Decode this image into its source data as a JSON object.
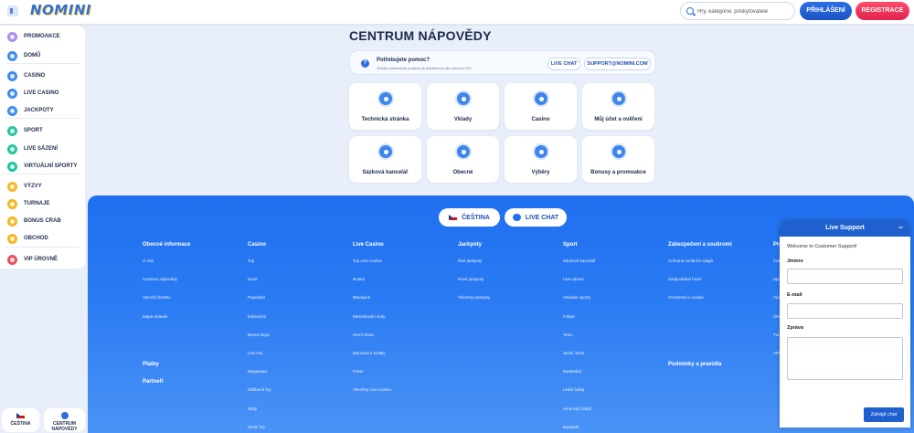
{
  "header": {
    "logo": "NOMINI",
    "search_placeholder": "Hry, kategorie, poskytovatelé",
    "login_label": "PŘIHLÁŠENÍ",
    "register_label": "REGISTRACE"
  },
  "sidebar": {
    "items": [
      {
        "label": "PROMOAKCE",
        "icon": "gift-icon",
        "color": "#a98cf0"
      },
      {
        "label": "DOMŮ",
        "icon": "home-icon",
        "color": "#3d8cf0"
      },
      {
        "label": "CASINO",
        "icon": "casino-icon",
        "color": "#3d8cf0"
      },
      {
        "label": "LIVE CASINO",
        "icon": "live-casino-icon",
        "color": "#3d8cf0"
      },
      {
        "label": "JACKPOTY",
        "icon": "jackpot-icon",
        "color": "#3d8cf0"
      },
      {
        "label": "SPORT",
        "icon": "sport-icon",
        "color": "#23c4a0"
      },
      {
        "label": "LIVE SÁZENÍ",
        "icon": "live-betting-icon",
        "color": "#23c4a0"
      },
      {
        "label": "VIRTUÁLNÍ SPORTY",
        "icon": "virtual-sports-icon",
        "color": "#23c4a0"
      },
      {
        "label": "VÝZVY",
        "icon": "challenge-icon",
        "color": "#f5b820"
      },
      {
        "label": "TURNAJE",
        "icon": "tournament-icon",
        "color": "#f5b820"
      },
      {
        "label": "BONUS CRAB",
        "icon": "crab-icon",
        "color": "#f5b820"
      },
      {
        "label": "OBCHOD",
        "icon": "shop-icon",
        "color": "#f5b820"
      },
      {
        "label": "VIP ÚROVNĚ",
        "icon": "vip-icon",
        "color": "#ef4f5e"
      }
    ],
    "bottom": [
      {
        "label": "ČEŠTINA",
        "icon": "flag-icon"
      },
      {
        "label": "CENTRUM NÁPOVĚDY",
        "icon": "help-icon"
      }
    ]
  },
  "main": {
    "title": "CENTRUM NÁPOVĚDY",
    "help": {
      "title": "Potřebujete pomoc?",
      "subtitle": "Služba zákaznické podpory je připravena vám pomoci 24/7",
      "live_chat": "LIVE CHAT",
      "email": "SUPPORT@NOMINI.COM"
    },
    "cards": [
      {
        "label": "Technická stránka",
        "icon": "gear-icon"
      },
      {
        "label": "Vklady",
        "icon": "coins-icon"
      },
      {
        "label": "Casino",
        "icon": "cards-icon"
      },
      {
        "label": "Můj účet a ověření",
        "icon": "user-icon"
      },
      {
        "label": "Sázková kancelář",
        "icon": "ball-icon"
      },
      {
        "label": "Obecné",
        "icon": "chip-icon"
      },
      {
        "label": "Výběry",
        "icon": "wallet-icon"
      },
      {
        "label": "Bonusy a promoakce",
        "icon": "gift-icon"
      }
    ]
  },
  "footer": {
    "language_button": "ČEŠTINA",
    "chat_button": "LIVE CHAT",
    "columns": [
      {
        "heading": "Obecné informace",
        "links": [
          "O nás",
          "Centrum nápovědy",
          "Vytvořit zkratku",
          "Mapa stránek"
        ],
        "extra": [
          "Platby",
          "Partneři"
        ]
      },
      {
        "heading": "Casino",
        "links": [
          "Top",
          "Nové",
          "Populární",
          "Exkluzivní",
          "Bonus Buys",
          "Live Hry",
          "Megaways",
          "Oblíbené hry",
          "Sloty",
          "Stolní hry"
        ]
      },
      {
        "heading": "Live Casino",
        "links": [
          "Top Live Casino",
          "Ruleta",
          "Blackjack",
          "Mezinárodní stoly",
          "Herní show",
          "Baccarat a kostky",
          "Poker",
          "Všechny Live Casino"
        ]
      },
      {
        "heading": "Jackpoty",
        "links": [
          "Živé jackpoty",
          "Nové jackpoty",
          "Všechny jackpoty"
        ]
      },
      {
        "heading": "Sport",
        "links": [
          "Sázková kancelář",
          "Live sázení",
          "Virtuální sporty",
          "Fotbal",
          "Tenis",
          "Stolní Tenis",
          "Basketbal",
          "Lední hokej",
          "Americký fotbal",
          "Baseball"
        ]
      },
      {
        "heading": "Zabezpečení a soukromí",
        "links": [
          "Ochrana osobních údajů",
          "Zodpovědné hraní",
          "Oznámení o cookie"
        ],
        "extra": [
          "Podmínky a pravidla"
        ]
      },
      {
        "heading": "Pro",
        "links": [
          "Casi",
          "Spor",
          "Výz",
          "Obc",
          "Turn",
          "VIP"
        ]
      }
    ]
  },
  "chat": {
    "title": "Live Support",
    "minimize": "−",
    "welcome": "Welcome to Customer Support!",
    "name_label": "Jméno",
    "email_label": "E-mail",
    "message_label": "Zpráva",
    "submit": "Zahájit chat"
  }
}
